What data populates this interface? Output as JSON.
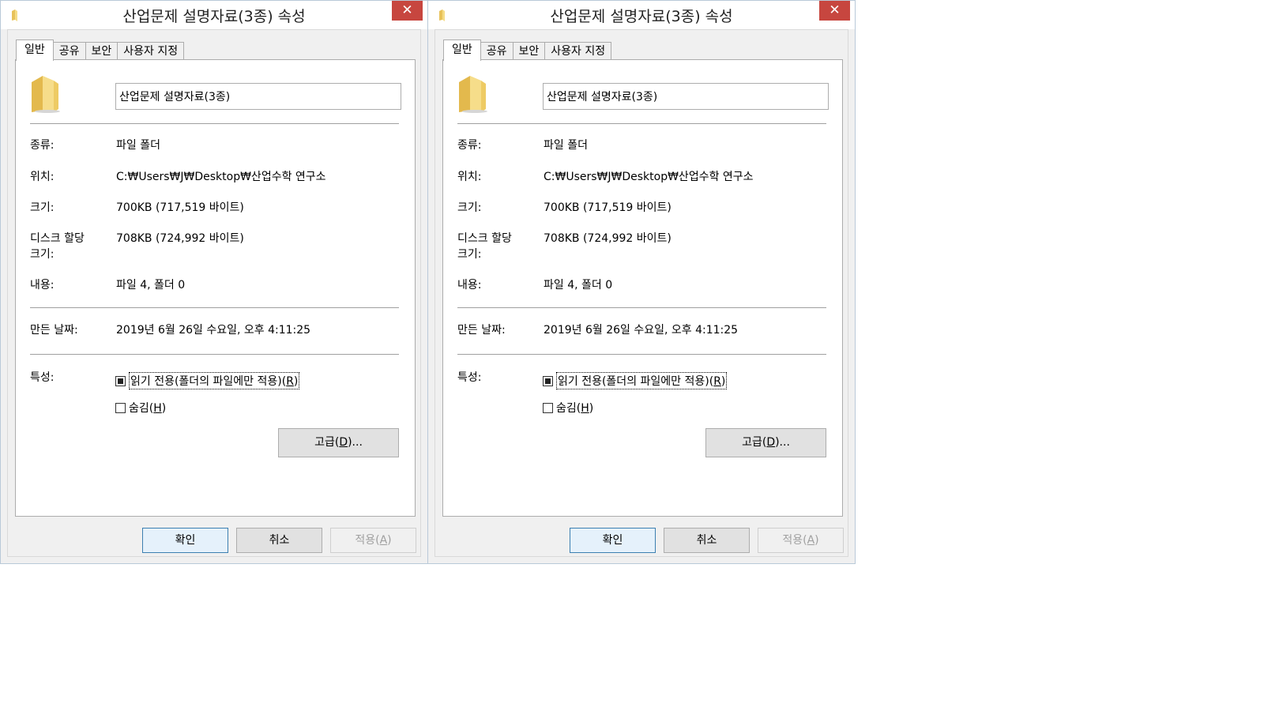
{
  "dialogs": [
    {
      "title": "산업문제 설명자료(3종) 속성",
      "close_label": "✕",
      "tabs": [
        "일반",
        "공유",
        "보안",
        "사용자 지정"
      ],
      "name_value": "산업문제 설명자료(3종)",
      "rows": {
        "type_label": "종류:",
        "type_value": "파일 폴더",
        "location_label": "위치:",
        "location_value": "C:₩Users₩J₩Desktop₩산업수학 연구소",
        "size_label": "크기:",
        "size_value": "700KB (717,519 바이트)",
        "disk_label": "디스크 할당 크기:",
        "disk_value": "708KB (724,992 바이트)",
        "contents_label": "내용:",
        "contents_value": "파일 4, 폴더 0",
        "created_label": "만든 날짜:",
        "created_value": "2019년 6월 26일 수요일, 오후 4:11:25",
        "attributes_label": "특성:"
      },
      "readonly_text": "읽기 전용(폴더의 파일에만 적용)(",
      "readonly_key": "R",
      "hidden_text": "숨김(",
      "hidden_key": "H",
      "advanced_text": "고급(",
      "advanced_key": "D",
      "advanced_suffix": ")...",
      "close_paren": ")",
      "ok_label": "확인",
      "cancel_label": "취소",
      "apply_text": "적용(",
      "apply_key": "A"
    },
    {
      "title": "산업문제 설명자료(3종) 속성",
      "close_label": "✕",
      "tabs": [
        "일반",
        "공유",
        "보안",
        "사용자 지정"
      ],
      "name_value": "산업문제 설명자료(3종)",
      "rows": {
        "type_label": "종류:",
        "type_value": "파일 폴더",
        "location_label": "위치:",
        "location_value": "C:₩Users₩J₩Desktop₩산업수학 연구소",
        "size_label": "크기:",
        "size_value": "700KB (717,519 바이트)",
        "disk_label": "디스크 할당 크기:",
        "disk_value": "708KB (724,992 바이트)",
        "contents_label": "내용:",
        "contents_value": "파일 4, 폴더 0",
        "created_label": "만든 날짜:",
        "created_value": "2019년 6월 26일 수요일, 오후 4:11:25",
        "attributes_label": "특성:"
      },
      "readonly_text": "읽기 전용(폴더의 파일에만 적용)(",
      "readonly_key": "R",
      "hidden_text": "숨김(",
      "hidden_key": "H",
      "advanced_text": "고급(",
      "advanced_key": "D",
      "advanced_suffix": ")...",
      "close_paren": ")",
      "ok_label": "확인",
      "cancel_label": "취소",
      "apply_text": "적용(",
      "apply_key": "A"
    }
  ],
  "colors": {
    "close_button": "#c7463f",
    "folder_yellow": "#f0d16a",
    "primary_border": "#3c7fb1"
  },
  "icons": {
    "title": "folder-icon",
    "big": "folder-icon",
    "close": "close-icon"
  },
  "state": {
    "readonly_checkbox": "indeterminate",
    "hidden_checkbox": "unchecked",
    "active_tab": "일반",
    "apply_enabled": false
  }
}
